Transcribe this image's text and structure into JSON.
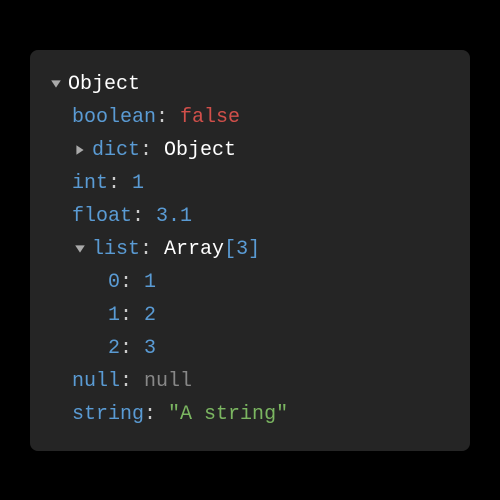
{
  "root_label": "Object",
  "boolean_key": "boolean",
  "boolean_val": "false",
  "dict_key": "dict",
  "dict_val": "Object",
  "int_key": "int",
  "int_val": "1",
  "float_key": "float",
  "float_val": "3.1",
  "list_key": "list",
  "list_val_name": "Array",
  "list_len": "3",
  "list_items": {
    "i0_key": "0",
    "i0_val": "1",
    "i1_key": "1",
    "i1_val": "2",
    "i2_key": "2",
    "i2_val": "3"
  },
  "null_key": "null",
  "null_val": "null",
  "string_key": "string",
  "string_val": "\"A string\"",
  "sep": ":",
  "space": " ",
  "open_br": "[",
  "close_br": "]"
}
